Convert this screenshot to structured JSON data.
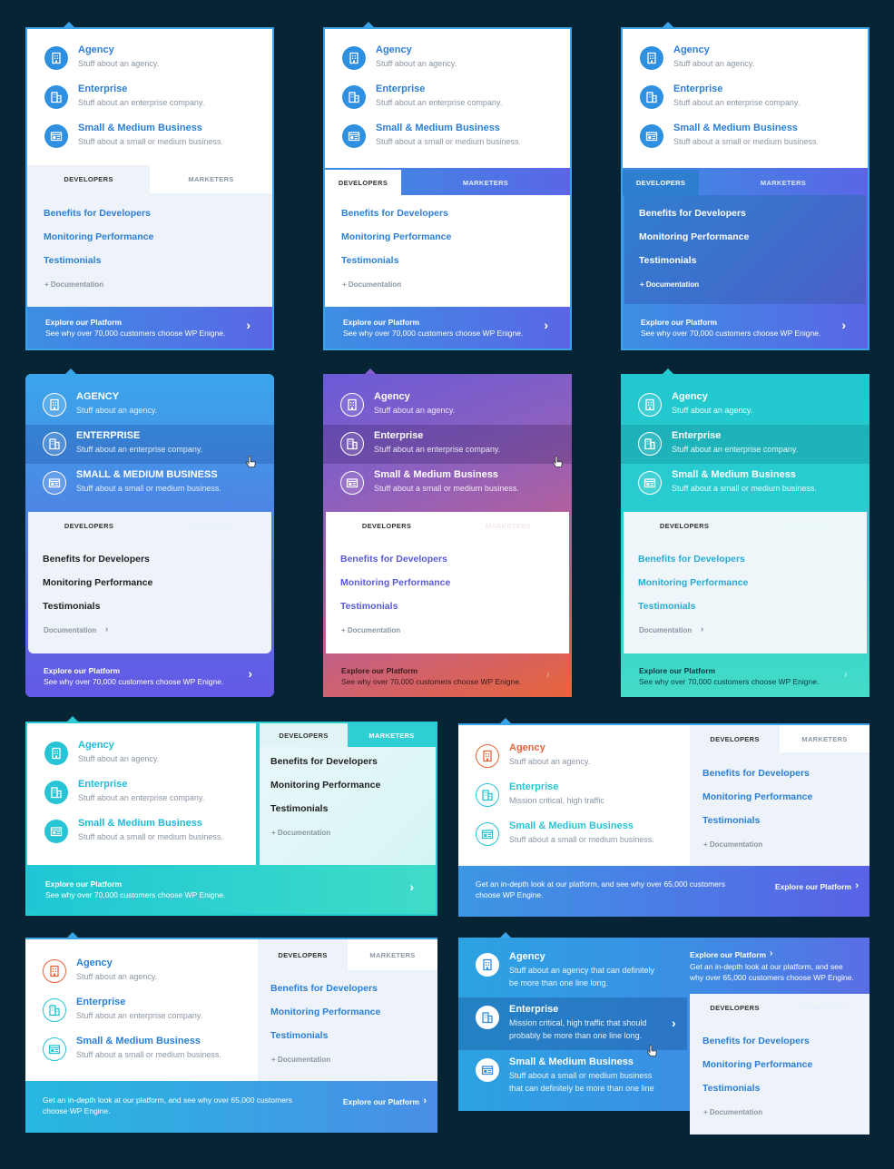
{
  "common": {
    "items": [
      {
        "title": "Agency",
        "sub": "Stuff about an agency."
      },
      {
        "title": "Enterprise",
        "sub": "Stuff about an enterprise company."
      },
      {
        "title": "Small & Medium Business",
        "sub": "Stuff about a small or medium business."
      }
    ],
    "items_caps": [
      {
        "title": "AGENCY",
        "sub": "Stuff about an agency."
      },
      {
        "title": "ENTERPRISE",
        "sub": "Stuff about an enterprise company."
      },
      {
        "title": "SMALL & MEDIUM BUSINESS",
        "sub": "Stuff about a small or medium business."
      }
    ],
    "items_alt": [
      {
        "title": "Agency",
        "sub": "Stuff about an agency."
      },
      {
        "title": "Enterprise",
        "sub": "Mission critical, high traffic"
      },
      {
        "title": "Small & Medium Business",
        "sub": "Stuff about a small or medium business."
      }
    ],
    "items_long": [
      {
        "title": "Agency",
        "sub1": "Stuff about an agency that can definitely",
        "sub2": "be more than one line long."
      },
      {
        "title": "Enterprise",
        "sub1": "Mission critical, high traffic that should",
        "sub2": "probably be more than one line long."
      },
      {
        "title": "Small & Medium Business",
        "sub1": "Stuff about a small or medium business",
        "sub2": "that can definitely be more than one line"
      }
    ],
    "tab_dev": "DEVELOPERS",
    "tab_mkt": "MARKETERS",
    "links": [
      "Benefits for Developers",
      "Monitoring Performance",
      "Testimonials"
    ],
    "doc_plus": "+ Documentation",
    "doc_arrow": "Documentation",
    "foot_title": "Explore our Platform",
    "foot_sub": "See why over 70,000 customers choose WP Enigne.",
    "foot_long1": "Get an in-depth look at our platform, and see why over 65,000 customers",
    "foot_long2": "choose WP Engine.",
    "foot_btn": "Explore our Platform",
    "top_long1": "Get an in-depth look at our platform, and see",
    "top_long2": "why over 65,000 customers choose WP Engine."
  },
  "colors": {
    "bg": "#062433",
    "blue": "#2a7fd6",
    "teal": "#27cbd3",
    "purple": "#7b5ad6",
    "orange": "#e8643a"
  },
  "icons": [
    "building-icon",
    "office-icon",
    "browser-icon"
  ]
}
